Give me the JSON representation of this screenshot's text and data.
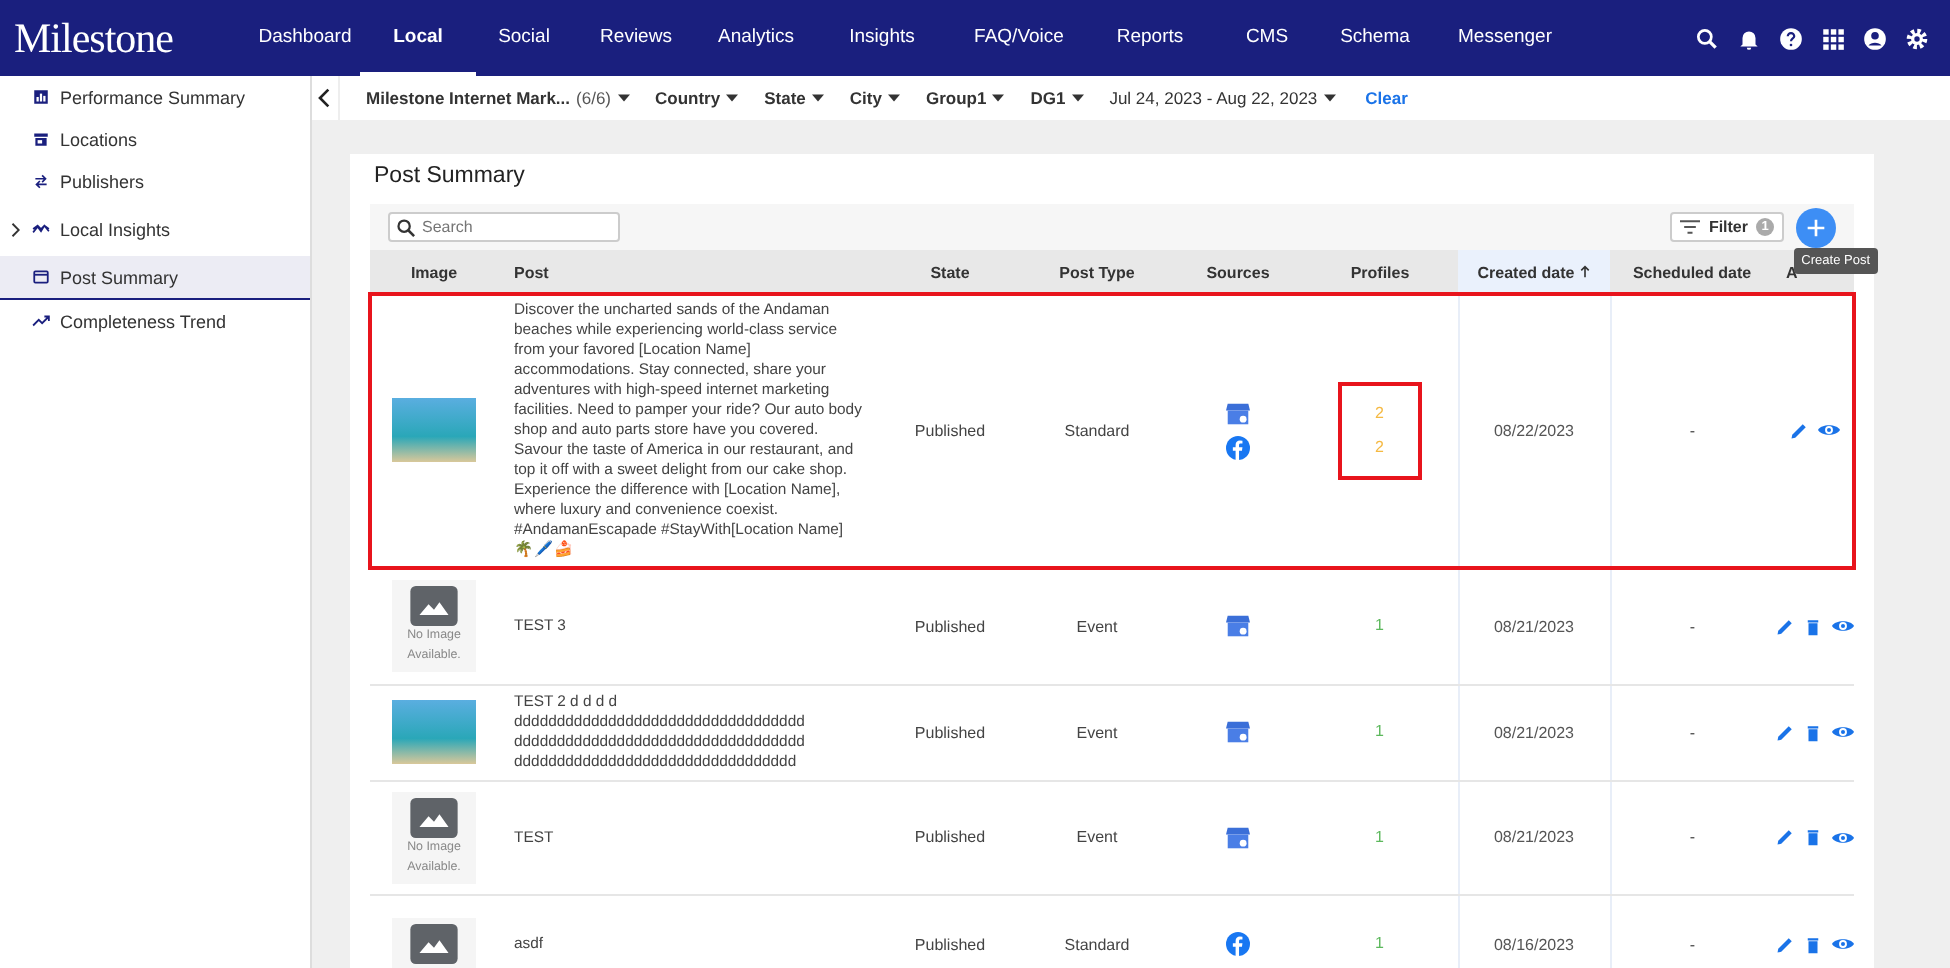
{
  "nav": {
    "logo": "Milestone",
    "items": [
      {
        "label": "Dashboard",
        "selected": false
      },
      {
        "label": "Local",
        "selected": true
      },
      {
        "label": "Social",
        "selected": false
      },
      {
        "label": "Reviews",
        "selected": false
      },
      {
        "label": "Analytics",
        "selected": false
      },
      {
        "label": "Insights",
        "selected": false
      },
      {
        "label": "FAQ/Voice",
        "selected": false
      },
      {
        "label": "Reports",
        "selected": false
      },
      {
        "label": "CMS",
        "selected": false
      },
      {
        "label": "Schema",
        "selected": false
      },
      {
        "label": "Messenger",
        "selected": false
      }
    ],
    "user_menu": true
  },
  "sidebar": {
    "items": [
      {
        "label": "Performance Summary",
        "selected": false,
        "expandable": false
      },
      {
        "label": "Locations",
        "selected": false,
        "expandable": false
      },
      {
        "label": "Publishers",
        "selected": false,
        "expandable": false
      },
      {
        "label": "Local Insights",
        "selected": false,
        "expandable": true
      },
      {
        "label": "Post Summary",
        "selected": true,
        "expandable": false
      },
      {
        "label": "Completeness Trend",
        "selected": false,
        "expandable": false
      }
    ]
  },
  "filters": [
    {
      "label": "Milestone Internet Mark...",
      "count": "(6/6)",
      "bold": true
    },
    {
      "label": "Country",
      "bold": true
    },
    {
      "label": "State",
      "bold": true
    },
    {
      "label": "City",
      "bold": true
    },
    {
      "label": "Group1",
      "bold": true
    },
    {
      "label": "DG1",
      "bold": true
    },
    {
      "label": "Jul 24, 2023 - Aug 22, 2023",
      "bold": false
    }
  ],
  "clear_link": "Clear",
  "card": {
    "title": "Post Summary",
    "search": {
      "placeholder": "Search"
    },
    "filter_button": {
      "label": "Filter",
      "badge": "1"
    },
    "create_tooltip": "Create Post"
  },
  "table": {
    "columns": [
      {
        "label": "Image",
        "sorted": false
      },
      {
        "label": "Post",
        "sorted": false
      },
      {
        "label": "State",
        "sorted": false
      },
      {
        "label": "Post Type",
        "sorted": false
      },
      {
        "label": "Sources",
        "sorted": false
      },
      {
        "label": "Profiles",
        "sorted": false
      },
      {
        "label": "Created date",
        "sorted": true
      },
      {
        "label": "Scheduled date",
        "sorted": false
      },
      {
        "label": "A",
        "sorted": false
      }
    ],
    "rows": [
      {
        "image": {
          "kind": "photo"
        },
        "post": "Discover the uncharted sands of the Andaman beaches while experiencing world-class service from your favored [Location Name] accommodations. Stay connected, share your adventures with high-speed internet marketing facilities. Need to pamper your ride? Our auto body shop and auto parts store have you covered. Savour the taste of America in our restaurant, and top it off with a sweet delight from our cake shop. Experience the difference with [Location Name], where luxury and convenience coexist. #AndamanEscapade #StayWith[Location Name] 🌴🖊️🍰",
        "state": "Published",
        "post_type": "Standard",
        "sources": [
          {
            "kind": "gmb",
            "profiles": "2",
            "color": "#f5b942"
          },
          {
            "kind": "facebook",
            "profiles": "2",
            "color": "#f5b942"
          }
        ],
        "created": "08/22/2023",
        "scheduled": "-",
        "deletable": false,
        "highlighted": true,
        "profiles_highlighted": true
      },
      {
        "image": {
          "kind": "none",
          "text": "No Image Available."
        },
        "post": "TEST 3",
        "state": "Published",
        "post_type": "Event",
        "sources": [
          {
            "kind": "gmb",
            "profiles": "1",
            "color": "#5cb85c"
          }
        ],
        "created": "08/21/2023",
        "scheduled": "-",
        "deletable": true,
        "highlighted": false,
        "profiles_highlighted": false
      },
      {
        "image": {
          "kind": "photo"
        },
        "post": "TEST 2 d d d d dddddddddddddddddddddddddddddddddd dddddddddddddddddddddddddddddddddd ddddddddddddddddddddddddddddddddd",
        "state": "Published",
        "post_type": "Event",
        "sources": [
          {
            "kind": "gmb",
            "profiles": "1",
            "color": "#5cb85c"
          }
        ],
        "created": "08/21/2023",
        "scheduled": "-",
        "deletable": true,
        "highlighted": false,
        "profiles_highlighted": false
      },
      {
        "image": {
          "kind": "none",
          "text": "No Image Available."
        },
        "post": "TEST",
        "state": "Published",
        "post_type": "Event",
        "sources": [
          {
            "kind": "gmb",
            "profiles": "1",
            "color": "#5cb85c"
          }
        ],
        "created": "08/21/2023",
        "scheduled": "-",
        "deletable": true,
        "highlighted": false,
        "profiles_highlighted": false
      },
      {
        "image": {
          "kind": "none"
        },
        "post": "asdf",
        "state": "Published",
        "post_type": "Standard",
        "sources": [
          {
            "kind": "facebook",
            "profiles": "1",
            "color": "#5cb85c"
          }
        ],
        "created": "08/16/2023",
        "scheduled": "-",
        "deletable": true,
        "highlighted": false,
        "profiles_highlighted": false
      }
    ]
  }
}
